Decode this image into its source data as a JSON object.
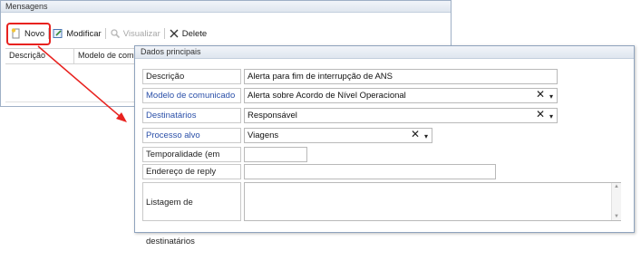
{
  "back_panel": {
    "title": "Mensagens",
    "toolbar": {
      "novo": "Novo",
      "modificar": "Modificar",
      "visualizar": "Visualizar",
      "delete": "Delete"
    },
    "grid_columns": [
      "Descrição",
      "Modelo de com"
    ]
  },
  "front_panel": {
    "title": "Dados principais",
    "fields": {
      "descricao": {
        "label": "Descrição",
        "value": "Alerta para fim de interrupção de ANS"
      },
      "modelo": {
        "label": "Modelo de comunicado",
        "value": "Alerta sobre Acordo de Nível Operacional"
      },
      "destinatarios": {
        "label": "Destinatários",
        "value": "Responsável"
      },
      "processo": {
        "label": "Processo alvo",
        "value": "Viagens"
      },
      "temporalidade": {
        "label": "Temporalidade (em dias)",
        "value": ""
      },
      "endereco": {
        "label": "Endereço de reply",
        "value": ""
      },
      "listagem": {
        "label": "Listagem de destinatários",
        "value": ""
      }
    }
  },
  "colors": {
    "highlight": "#e8221f",
    "link_label": "#2a4fa8"
  }
}
